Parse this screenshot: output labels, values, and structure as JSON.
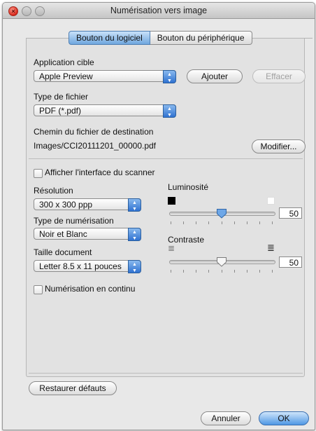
{
  "window": {
    "title": "Numérisation vers image"
  },
  "tabs": [
    {
      "label": "Bouton du logiciel",
      "active": true
    },
    {
      "label": "Bouton du périphérique",
      "active": false
    }
  ],
  "target_app": {
    "label": "Application cible",
    "value": "Apple Preview",
    "add_label": "Ajouter",
    "delete_label": "Effacer"
  },
  "file_type": {
    "label": "Type de fichier",
    "value": "PDF (*.pdf)"
  },
  "destination": {
    "label": "Chemin du fichier de destination",
    "path": "Images/CCI20111201_00000.pdf",
    "modify_label": "Modifier..."
  },
  "show_scanner_ui": {
    "label": "Afficher l'interface du scanner",
    "checked": false
  },
  "resolution": {
    "label": "Résolution",
    "value": "300 x 300 ppp"
  },
  "scan_type": {
    "label": "Type de numérisation",
    "value": "Noir et Blanc"
  },
  "doc_size": {
    "label": "Taille document",
    "value": "Letter 8.5 x 11 pouces"
  },
  "continuous_scan": {
    "label": "Numérisation en continu",
    "checked": false
  },
  "brightness": {
    "label": "Luminosité",
    "value": "50",
    "level": 0.5
  },
  "contrast": {
    "label": "Contraste",
    "value": "50",
    "level": 0.5
  },
  "restore_label": "Restaurer défauts",
  "footer": {
    "cancel_label": "Annuler",
    "ok_label": "OK"
  },
  "colors": {
    "accent": "#5b9be3",
    "window_bg": "#e8e8e8"
  }
}
